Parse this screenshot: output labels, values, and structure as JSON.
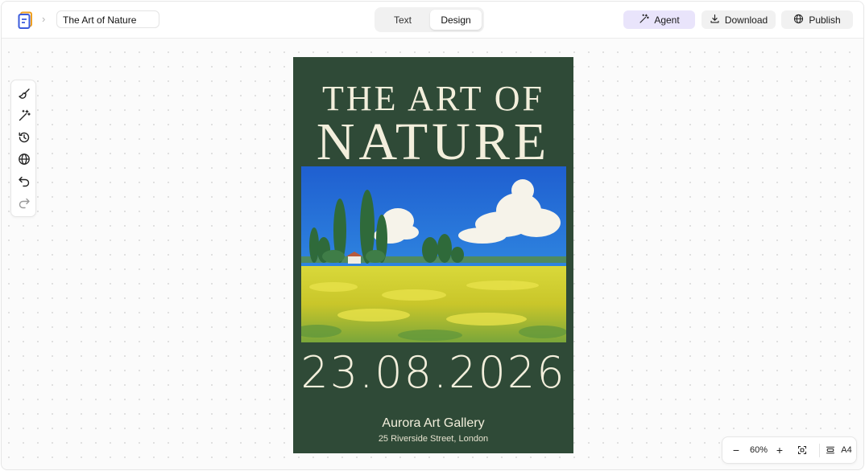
{
  "topbar": {
    "doc_title": "The Art of Nature",
    "tabs": [
      {
        "label": "Text",
        "active": false
      },
      {
        "label": "Design",
        "active": true
      }
    ],
    "agent_label": "Agent",
    "download_label": "Download",
    "publish_label": "Publish"
  },
  "icons": {
    "logo": "document-logo-icon",
    "agent": "magic-wand-icon",
    "download": "download-icon",
    "publish": "globe-icon"
  },
  "left_toolbar": [
    {
      "name": "brush-icon"
    },
    {
      "name": "magic-wand-icon"
    },
    {
      "name": "history-icon"
    },
    {
      "name": "globe-icon"
    },
    {
      "name": "undo-icon"
    },
    {
      "name": "redo-icon",
      "disabled": true
    }
  ],
  "poster": {
    "title_line1": "THE ART OF",
    "title_line2": "NATURE",
    "date": "23.08.2026",
    "gallery": "Aurora Art Gallery",
    "address": "25 Riverside Street, London",
    "background": "#2f4a37",
    "text_color": "#f3efdc"
  },
  "zoom": {
    "minus": "−",
    "level": "60%",
    "plus": "+",
    "page_size": "A4"
  },
  "colors": {
    "accent": "#e9e4fb",
    "logo_orange": "#f0a020",
    "logo_blue": "#3b5bdb"
  }
}
